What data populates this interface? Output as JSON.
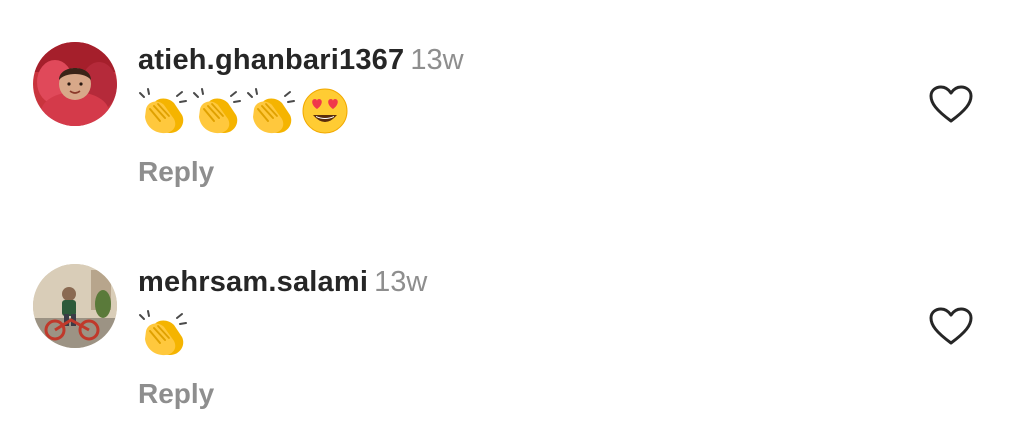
{
  "comments": [
    {
      "username": "atieh.ghanbari1367",
      "age": "13w",
      "emojis": [
        "clapping-hands-emoji",
        "clapping-hands-emoji",
        "clapping-hands-emoji",
        "heart-eyes-emoji"
      ],
      "reply_label": "Reply",
      "liked": false
    },
    {
      "username": "mehrsam.salami",
      "age": "13w",
      "emojis": [
        "clapping-hands-emoji"
      ],
      "reply_label": "Reply",
      "liked": false
    }
  ],
  "colors": {
    "username": "#262626",
    "meta": "#8e8e8e",
    "heart_outline": "#262626"
  }
}
